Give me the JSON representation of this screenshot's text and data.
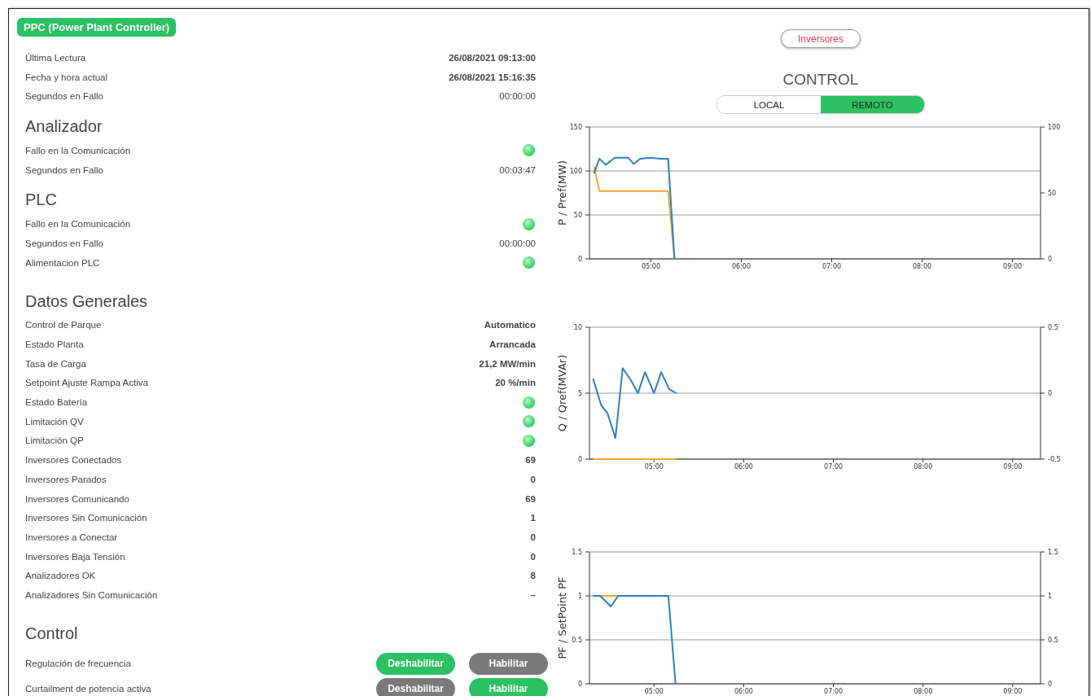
{
  "header": {
    "title": "PPC (Power Plant Controller)"
  },
  "sections": [
    {
      "rows": [
        {
          "label": "Última Lectura",
          "kind": "bold_text",
          "value": "26/08/2021 09:13:00"
        },
        {
          "label": "Fecha y hora actual",
          "kind": "bold_text",
          "value": "26/08/2021 15:16:35"
        },
        {
          "label": "Segundos en Fallo",
          "kind": "text",
          "value": "00:00:00"
        }
      ]
    },
    {
      "title": "Analizador",
      "rows": [
        {
          "label": "Fallo en la Comunicación",
          "kind": "led",
          "on": true
        },
        {
          "label": "Segundos en Fallo",
          "kind": "text",
          "value": "00:03:47"
        }
      ]
    },
    {
      "title": "PLC",
      "rows": [
        {
          "label": "Fallo en la Comunicación",
          "kind": "led",
          "on": true
        },
        {
          "label": "Segundos en Fallo",
          "kind": "text",
          "value": "00:00:00"
        },
        {
          "label": "Alimentacion PLC",
          "kind": "led",
          "on": true
        }
      ]
    },
    {
      "title": "Datos Generales",
      "rows": [
        {
          "label": "Control de Parque",
          "kind": "bold_text",
          "value": "Automatico"
        },
        {
          "label": "Estado Planta",
          "kind": "bold_text",
          "value": "Arrancada"
        },
        {
          "label": "Tasa de Carga",
          "kind": "bold_text",
          "value": "21,2 MW/min"
        },
        {
          "label": "Setpoint Ajuste Rampa Activa",
          "kind": "bold_text",
          "value": "20 %/min"
        },
        {
          "label": "Estado Batería",
          "kind": "led",
          "on": true
        },
        {
          "label": "Limitación QV",
          "kind": "led",
          "on": true
        },
        {
          "label": "Limitación QP",
          "kind": "led",
          "on": true
        },
        {
          "label": "Inversores Conectados",
          "kind": "bold_text",
          "value": "69"
        },
        {
          "label": "Inversores Parados",
          "kind": "bold_text",
          "value": "0"
        },
        {
          "label": "Inversores Comunicando",
          "kind": "bold_text",
          "value": "69"
        },
        {
          "label": "Inversores Sin Comunicación",
          "kind": "bold_text",
          "value": "1"
        },
        {
          "label": "Inversores a Conectar",
          "kind": "bold_text",
          "value": "0"
        },
        {
          "label": "Inversores Baja Tensión",
          "kind": "bold_text",
          "value": "0"
        },
        {
          "label": "Analizadores OK",
          "kind": "bold_text",
          "value": "8"
        },
        {
          "label": "Analizadores Sin Comunicación",
          "kind": "bold_text",
          "value": "–"
        }
      ]
    },
    {
      "title": "Control",
      "rows": [
        {
          "label": "Regulación de frecuencia",
          "kind": "buttons",
          "buttons": [
            {
              "label": "Deshabilitar",
              "selected": true
            },
            {
              "label": "Habilitar",
              "selected": false
            }
          ]
        },
        {
          "label": "Curtailment de potencia activa",
          "kind": "buttons",
          "buttons": [
            {
              "label": "Deshabilitar",
              "selected": false
            },
            {
              "label": "Habilitar",
              "selected": true
            }
          ]
        }
      ]
    }
  ],
  "inverters_button": "Inversores",
  "control": {
    "title": "CONTROL",
    "modes": [
      {
        "label": "LOCAL",
        "selected": false
      },
      {
        "label": "REMOTO",
        "selected": true
      }
    ]
  },
  "charts": [
    {
      "right_ticks": [
        "100",
        "50",
        "0"
      ],
      "chart_data": {
        "type": "line",
        "ylabel": "P  /  Pref(MW)",
        "x": [
          4.37,
          4.43,
          4.5,
          4.6,
          4.75,
          4.81,
          4.88,
          5.0,
          5.1,
          5.19,
          5.26
        ],
        "series": [
          {
            "color": "#f5a623",
            "values": [
              105,
              77,
              77,
              77,
              77,
              77,
              77,
              77,
              77,
              77,
              0
            ]
          },
          {
            "color": "#2f7fc1",
            "values": [
              97,
              114,
              107,
              115,
              115,
              108,
              114,
              115,
              114,
              114,
              0
            ]
          }
        ],
        "xlim": [
          4.32,
          9.31
        ],
        "ylim": [
          0,
          150
        ],
        "xticks": [
          {
            "value": 5,
            "label": "05:00"
          },
          {
            "value": 6,
            "label": "06:00"
          },
          {
            "value": 7,
            "label": "07:00"
          },
          {
            "value": 8,
            "label": "08:00"
          },
          {
            "value": 9,
            "label": "09:00"
          }
        ],
        "yticks": [
          0,
          50,
          100,
          150
        ]
      }
    },
    {
      "right_ticks": [
        "0.5",
        "0",
        "-0.5"
      ],
      "chart_data": {
        "type": "line",
        "ylabel": "Q  /  Qref(MVAr)",
        "x": [
          4.32,
          4.41,
          4.48,
          4.57,
          4.65,
          4.74,
          4.82,
          4.9,
          5.0,
          5.08,
          5.17,
          5.25
        ],
        "series": [
          {
            "color": "#f5a623",
            "values": [
              0,
              0,
              0,
              0,
              0,
              0,
              0,
              0,
              0,
              0,
              0,
              0
            ]
          },
          {
            "color": "#2f7fc1",
            "values": [
              6.1,
              4.1,
              3.5,
              1.6,
              6.9,
              6.0,
              5.0,
              6.6,
              5.0,
              6.6,
              5.3,
              5.0
            ]
          }
        ],
        "xlim": [
          4.28,
          9.31
        ],
        "ylim": [
          0,
          10
        ],
        "xticks": [
          {
            "value": 5,
            "label": "05:00"
          },
          {
            "value": 6,
            "label": "06:00"
          },
          {
            "value": 7,
            "label": "07:00"
          },
          {
            "value": 8,
            "label": "08:00"
          },
          {
            "value": 9,
            "label": "09:00"
          }
        ],
        "yticks": [
          0,
          5,
          10
        ]
      }
    },
    {
      "right_ticks": [
        "1.5",
        "1",
        "0.5",
        "0"
      ],
      "chart_data": {
        "type": "line",
        "ylabel": "PF  /  SetPoint PF",
        "x": [
          4.32,
          4.4,
          4.52,
          4.6,
          5.16,
          5.24
        ],
        "series": [
          {
            "color": "#f5a623",
            "values": [
              null,
              1,
              1,
              1,
              null,
              null
            ]
          },
          {
            "color": "#2f7fc1",
            "values": [
              1,
              1,
              0.88,
              1,
              1,
              0
            ]
          }
        ],
        "xlim": [
          4.28,
          9.31
        ],
        "ylim": [
          0,
          1.5
        ],
        "xticks": [
          {
            "value": 5,
            "label": "05:00"
          },
          {
            "value": 6,
            "label": "06:00"
          },
          {
            "value": 7,
            "label": "07:00"
          },
          {
            "value": 8,
            "label": "08:00"
          },
          {
            "value": 9,
            "label": "09:00"
          }
        ],
        "yticks": [
          {
            "value": 0,
            "label": "0"
          },
          {
            "value": 0.5,
            "label": "0.5"
          },
          {
            "value": 1,
            "label": "1"
          },
          {
            "value": 1.5,
            "label": "1.5"
          }
        ]
      }
    }
  ]
}
